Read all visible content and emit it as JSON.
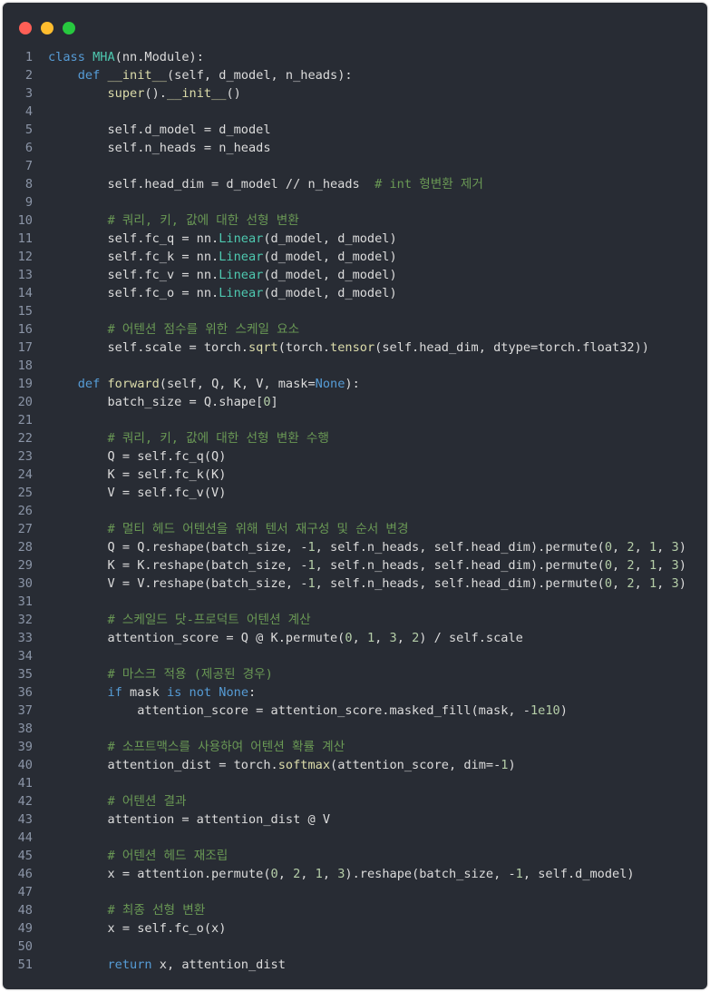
{
  "window": {
    "controls": {
      "close": "red-dot",
      "minimize": "yellow-dot",
      "maximize": "green-dot"
    }
  },
  "colors": {
    "background": "#282c34",
    "keyword": "#569cd6",
    "class": "#4ec9b0",
    "function": "#dcdcaa",
    "comment": "#6a9955",
    "number": "#b5cea8",
    "text": "#dcdcdc"
  },
  "code": {
    "lines": [
      [
        [
          "kw",
          "class"
        ],
        [
          "pl",
          " "
        ],
        [
          "cls",
          "MHA"
        ],
        [
          "pl",
          "(nn.Module):"
        ]
      ],
      [
        [
          "pl",
          "    "
        ],
        [
          "kw",
          "def"
        ],
        [
          "pl",
          " "
        ],
        [
          "fn",
          "__init__"
        ],
        [
          "pl",
          "(self, d_model, n_heads):"
        ]
      ],
      [
        [
          "pl",
          "        "
        ],
        [
          "fn",
          "super"
        ],
        [
          "pl",
          "()."
        ],
        [
          "fn",
          "__init__"
        ],
        [
          "pl",
          "()"
        ]
      ],
      [],
      [
        [
          "pl",
          "        self.d_model = d_model"
        ]
      ],
      [
        [
          "pl",
          "        self.n_heads = n_heads"
        ]
      ],
      [],
      [
        [
          "pl",
          "        self.head_dim = d_model // n_heads  "
        ],
        [
          "cm",
          "# int 형변환 제거"
        ]
      ],
      [],
      [
        [
          "pl",
          "        "
        ],
        [
          "cm",
          "# 쿼리, 키, 값에 대한 선형 변환"
        ]
      ],
      [
        [
          "pl",
          "        self.fc_q = nn."
        ],
        [
          "cls",
          "Linear"
        ],
        [
          "pl",
          "(d_model, d_model)"
        ]
      ],
      [
        [
          "pl",
          "        self.fc_k = nn."
        ],
        [
          "cls",
          "Linear"
        ],
        [
          "pl",
          "(d_model, d_model)"
        ]
      ],
      [
        [
          "pl",
          "        self.fc_v = nn."
        ],
        [
          "cls",
          "Linear"
        ],
        [
          "pl",
          "(d_model, d_model)"
        ]
      ],
      [
        [
          "pl",
          "        self.fc_o = nn."
        ],
        [
          "cls",
          "Linear"
        ],
        [
          "pl",
          "(d_model, d_model)"
        ]
      ],
      [],
      [
        [
          "pl",
          "        "
        ],
        [
          "cm",
          "# 어텐션 점수를 위한 스케일 요소"
        ]
      ],
      [
        [
          "pl",
          "        self.scale = torch."
        ],
        [
          "fn",
          "sqrt"
        ],
        [
          "pl",
          "(torch."
        ],
        [
          "fn",
          "tensor"
        ],
        [
          "pl",
          "(self.head_dim, dtype=torch.float32))"
        ]
      ],
      [],
      [
        [
          "pl",
          "    "
        ],
        [
          "kw",
          "def"
        ],
        [
          "pl",
          " "
        ],
        [
          "fn",
          "forward"
        ],
        [
          "pl",
          "(self, Q, K, V, mask="
        ],
        [
          "kw",
          "None"
        ],
        [
          "pl",
          "):"
        ]
      ],
      [
        [
          "pl",
          "        batch_size = Q.shape["
        ],
        [
          "nm",
          "0"
        ],
        [
          "pl",
          "]"
        ]
      ],
      [],
      [
        [
          "pl",
          "        "
        ],
        [
          "cm",
          "# 쿼리, 키, 값에 대한 선형 변환 수행"
        ]
      ],
      [
        [
          "pl",
          "        Q = self.fc_q(Q)"
        ]
      ],
      [
        [
          "pl",
          "        K = self.fc_k(K)"
        ]
      ],
      [
        [
          "pl",
          "        V = self.fc_v(V)"
        ]
      ],
      [],
      [
        [
          "pl",
          "        "
        ],
        [
          "cm",
          "# 멀티 헤드 어텐션을 위해 텐서 재구성 및 순서 변경"
        ]
      ],
      [
        [
          "pl",
          "        Q = Q.reshape(batch_size, -"
        ],
        [
          "nm",
          "1"
        ],
        [
          "pl",
          ", self.n_heads, self.head_dim).permute("
        ],
        [
          "nm",
          "0"
        ],
        [
          "pl",
          ", "
        ],
        [
          "nm",
          "2"
        ],
        [
          "pl",
          ", "
        ],
        [
          "nm",
          "1"
        ],
        [
          "pl",
          ", "
        ],
        [
          "nm",
          "3"
        ],
        [
          "pl",
          ")"
        ]
      ],
      [
        [
          "pl",
          "        K = K.reshape(batch_size, -"
        ],
        [
          "nm",
          "1"
        ],
        [
          "pl",
          ", self.n_heads, self.head_dim).permute("
        ],
        [
          "nm",
          "0"
        ],
        [
          "pl",
          ", "
        ],
        [
          "nm",
          "2"
        ],
        [
          "pl",
          ", "
        ],
        [
          "nm",
          "1"
        ],
        [
          "pl",
          ", "
        ],
        [
          "nm",
          "3"
        ],
        [
          "pl",
          ")"
        ]
      ],
      [
        [
          "pl",
          "        V = V.reshape(batch_size, -"
        ],
        [
          "nm",
          "1"
        ],
        [
          "pl",
          ", self.n_heads, self.head_dim).permute("
        ],
        [
          "nm",
          "0"
        ],
        [
          "pl",
          ", "
        ],
        [
          "nm",
          "2"
        ],
        [
          "pl",
          ", "
        ],
        [
          "nm",
          "1"
        ],
        [
          "pl",
          ", "
        ],
        [
          "nm",
          "3"
        ],
        [
          "pl",
          ")"
        ]
      ],
      [],
      [
        [
          "pl",
          "        "
        ],
        [
          "cm",
          "# 스케일드 닷-프로덕트 어텐션 계산"
        ]
      ],
      [
        [
          "pl",
          "        attention_score = Q @ K.permute("
        ],
        [
          "nm",
          "0"
        ],
        [
          "pl",
          ", "
        ],
        [
          "nm",
          "1"
        ],
        [
          "pl",
          ", "
        ],
        [
          "nm",
          "3"
        ],
        [
          "pl",
          ", "
        ],
        [
          "nm",
          "2"
        ],
        [
          "pl",
          ") / self.scale"
        ]
      ],
      [],
      [
        [
          "pl",
          "        "
        ],
        [
          "cm",
          "# 마스크 적용 (제공된 경우)"
        ]
      ],
      [
        [
          "pl",
          "        "
        ],
        [
          "kw",
          "if"
        ],
        [
          "pl",
          " mask "
        ],
        [
          "kw",
          "is not"
        ],
        [
          "pl",
          " "
        ],
        [
          "kw",
          "None"
        ],
        [
          "pl",
          ":"
        ]
      ],
      [
        [
          "pl",
          "            attention_score = attention_score.masked_fill(mask, -"
        ],
        [
          "nm",
          "1e10"
        ],
        [
          "pl",
          ")"
        ]
      ],
      [],
      [
        [
          "pl",
          "        "
        ],
        [
          "cm",
          "# 소프트맥스를 사용하여 어텐션 확률 계산"
        ]
      ],
      [
        [
          "pl",
          "        attention_dist = torch."
        ],
        [
          "fn",
          "softmax"
        ],
        [
          "pl",
          "(attention_score, dim=-"
        ],
        [
          "nm",
          "1"
        ],
        [
          "pl",
          ")"
        ]
      ],
      [],
      [
        [
          "pl",
          "        "
        ],
        [
          "cm",
          "# 어텐션 결과"
        ]
      ],
      [
        [
          "pl",
          "        attention = attention_dist @ V"
        ]
      ],
      [],
      [
        [
          "pl",
          "        "
        ],
        [
          "cm",
          "# 어텐션 헤드 재조립"
        ]
      ],
      [
        [
          "pl",
          "        x = attention.permute("
        ],
        [
          "nm",
          "0"
        ],
        [
          "pl",
          ", "
        ],
        [
          "nm",
          "2"
        ],
        [
          "pl",
          ", "
        ],
        [
          "nm",
          "1"
        ],
        [
          "pl",
          ", "
        ],
        [
          "nm",
          "3"
        ],
        [
          "pl",
          ").reshape(batch_size, -"
        ],
        [
          "nm",
          "1"
        ],
        [
          "pl",
          ", self.d_model)"
        ]
      ],
      [],
      [
        [
          "pl",
          "        "
        ],
        [
          "cm",
          "# 최종 선형 변환"
        ]
      ],
      [
        [
          "pl",
          "        x = self.fc_o(x)"
        ]
      ],
      [],
      [
        [
          "pl",
          "        "
        ],
        [
          "kw",
          "return"
        ],
        [
          "pl",
          " x, attention_dist"
        ]
      ]
    ]
  }
}
